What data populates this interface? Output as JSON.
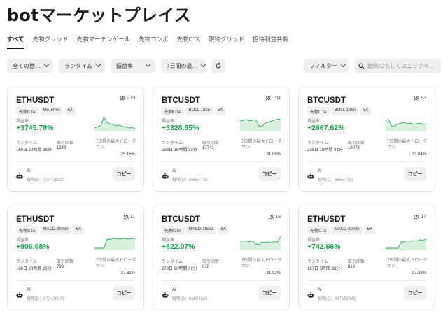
{
  "title": "botマーケットプレイス",
  "tabs": [
    "すべて",
    "先物グリッド",
    "先物マーチンゲール",
    "先物コンボ",
    "先物CTA",
    "現物グリッド",
    "招待利益共有"
  ],
  "filters": {
    "all_types": "全ての箇…",
    "runtime": "ランタイム",
    "roi": "損益率",
    "drawdown": "7日間の最…",
    "filter": "フィルター",
    "search_placeholder": "戦略IDもしくはニックネ…"
  },
  "labels": {
    "roi": "損益率",
    "runtime": "ランタイム",
    "trades": "取引回数",
    "drawdown": "7日間の最大ドローダウン",
    "ai": "AI",
    "copy": "コピー"
  },
  "colors": {
    "profit": "#1aa34a",
    "chart_fill": "#d9f0de",
    "chart_line": "#2fb05a"
  },
  "cards": [
    {
      "pair": "ETHUSDT",
      "users": "279",
      "tags": [
        "先物CTA",
        "MA-5min",
        "5X"
      ],
      "roi": "+3745.78%",
      "runtime": "160日 20時間 26分",
      "trades": "1249",
      "drawdown": "25.15%",
      "strategy_id": "戦略ID：670426937",
      "spark": [
        0.2,
        0.3,
        0.35,
        0.95,
        0.6,
        0.5,
        0.45,
        0.35,
        0.4,
        0.3,
        0.28,
        0.2,
        0.22,
        0.18
      ]
    },
    {
      "pair": "BTCUSDT",
      "users": "104",
      "tags": [
        "先物CTA",
        "BOLL-1min",
        "5X"
      ],
      "roi": "+3328.85%",
      "runtime": "238日 16時間 33分",
      "trades": "17741",
      "drawdown": "31.88%",
      "strategy_id": "戦略ID：66657733",
      "spark": [
        0.7,
        0.75,
        0.8,
        0.7,
        0.75,
        0.8,
        0.35,
        0.3,
        0.55,
        0.6,
        0.7,
        0.75,
        0.85,
        0.8
      ]
    },
    {
      "pair": "BTCUSDT",
      "users": "83",
      "tags": [
        "先物CTA",
        "BOLL-1min",
        "5X"
      ],
      "roi": "+2667.62%",
      "runtime": "238日 16時間 34分",
      "trades": "18073",
      "drawdown": "33.04%",
      "strategy_id": "戦略ID：66657732",
      "spark": [
        0.75,
        0.8,
        0.3,
        0.35,
        0.5,
        0.55,
        0.6,
        0.5,
        0.55,
        0.45,
        0.5,
        0.55,
        0.45,
        0.5
      ]
    },
    {
      "pair": "ETHUSDT",
      "users": "11",
      "tags": [
        "先物CTA",
        "MACD-30min",
        "5X"
      ],
      "roi": "+906.68%",
      "runtime": "160日 20時間 26分",
      "trades": "793",
      "drawdown": "27.31%",
      "strategy_id": "戦略ID：670426876",
      "spark": [
        0.1,
        0.1,
        0.1,
        0.1,
        0.75,
        0.72,
        0.8,
        0.78,
        0.75,
        0.8,
        0.78,
        0.75,
        0.8,
        0.78
      ]
    },
    {
      "pair": "BTCUSDT",
      "users": "18",
      "tags": [
        "先物CTA",
        "MACD-1hour",
        "5X"
      ],
      "roi": "+822.07%",
      "runtime": "279日 20時間 39分",
      "trades": "610",
      "drawdown": "21.92%",
      "strategy_id": "戦略ID：66654825",
      "spark": [
        0.6,
        0.62,
        0.6,
        0.58,
        0.62,
        0.4,
        0.35,
        0.55,
        0.5,
        0.55,
        0.5,
        0.6,
        0.55,
        0.95
      ]
    },
    {
      "pair": "ETHUSDT",
      "users": "17",
      "tags": [
        "先物CTA",
        "MACD-30min",
        "5X"
      ],
      "roi": "+742.66%",
      "runtime": "197日 5時間 38分",
      "trades": "819",
      "drawdown": "27.33%",
      "strategy_id": "戦略ID：667151645",
      "spark": [
        0.1,
        0.1,
        0.1,
        0.1,
        0.1,
        0.55,
        0.6,
        0.62,
        0.6,
        0.65,
        0.62,
        0.7,
        0.68,
        0.75
      ]
    }
  ]
}
